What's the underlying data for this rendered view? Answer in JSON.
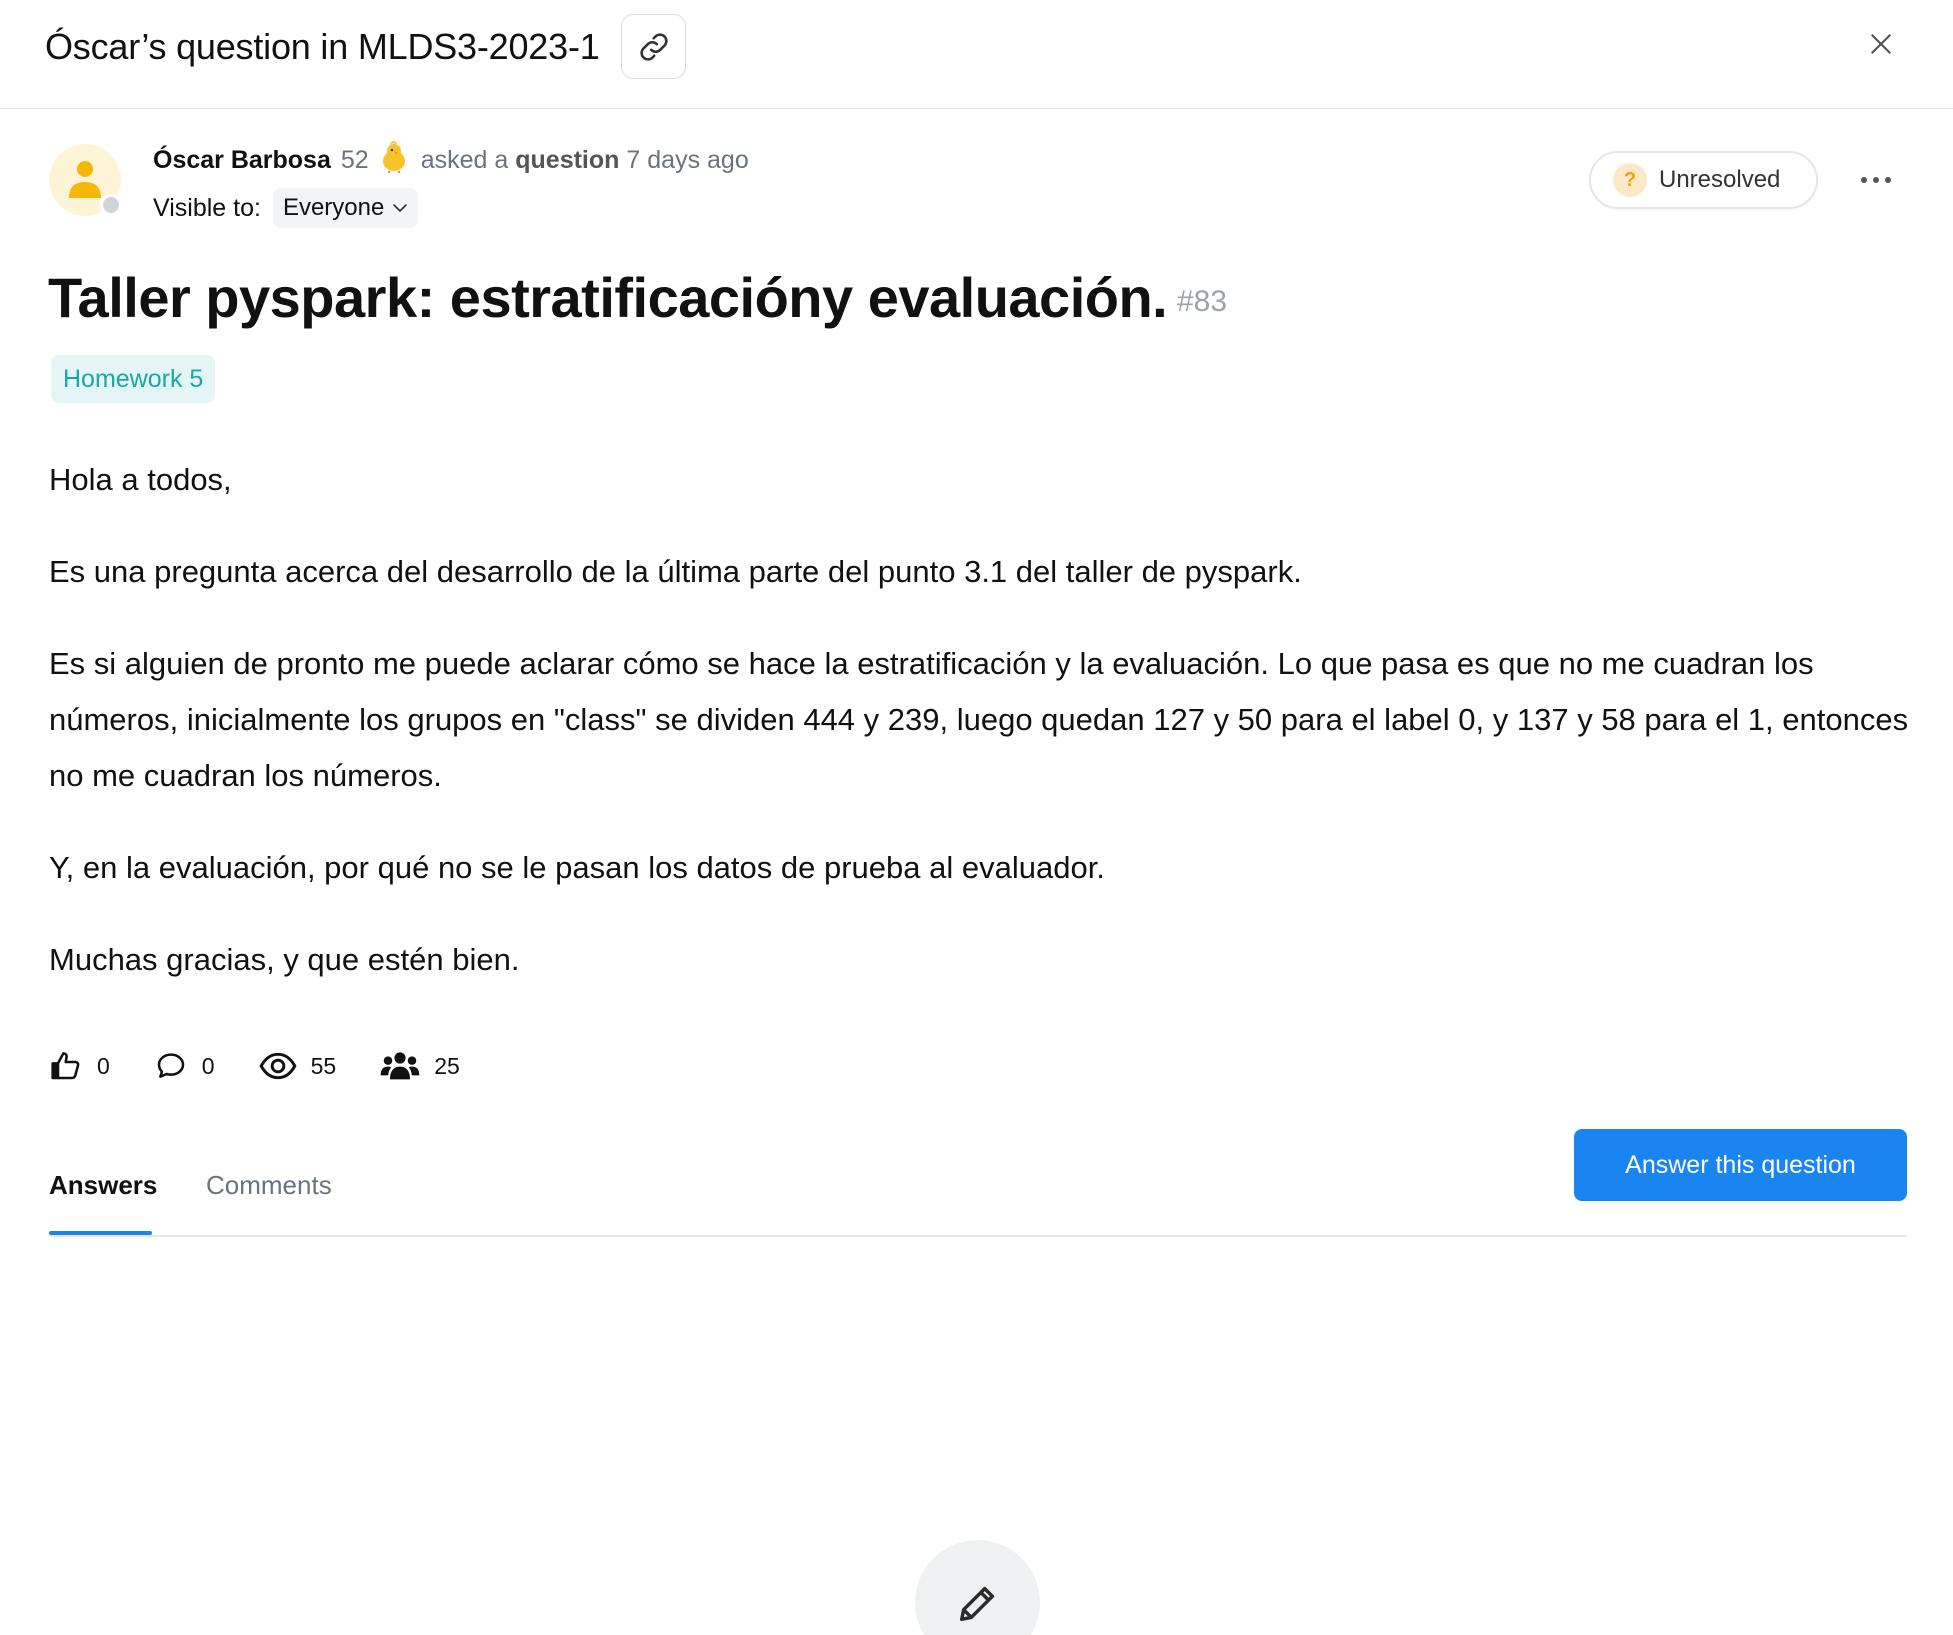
{
  "header": {
    "title": "Óscar’s question in MLDS3-2023-1",
    "copy_link_icon": "link-icon",
    "close_icon": "close-icon"
  },
  "author": {
    "name": "Óscar Barbosa",
    "score": "52",
    "badge_icon": "chick-icon",
    "action_prefix": "asked a",
    "action_object": "question",
    "time": "7 days ago",
    "visible_label": "Visible to:",
    "visibility": "Everyone"
  },
  "status": {
    "label": "Unresolved",
    "icon_glyph": "?",
    "color": "#f59e0b"
  },
  "post": {
    "title": "Taller pyspark: estratificacióny evaluación.",
    "number": "#83",
    "tag": "Homework 5",
    "paragraphs": [
      "Hola a todos,",
      "Es una pregunta acerca del desarrollo de la última parte del punto 3.1 del taller de pyspark.",
      "Es si alguien de pronto me puede aclarar cómo se hace la estratificación y la evaluación. Lo que pasa es que no me cuadran los números, inicialmente los grupos en \"class\" se dividen 444 y 239, luego quedan 127 y 50 para el label 0, y 137 y 58 para el 1, entonces no me cuadran los números.",
      "Y, en la evaluación, por qué no se le pasan los datos de prueba al evaluador.",
      "Muchas gracias, y que estén bien."
    ]
  },
  "stats": {
    "likes": "0",
    "comments": "0",
    "views": "55",
    "participants": "25"
  },
  "tabs": {
    "answers": "Answers",
    "comments": "Comments",
    "active": "Answers"
  },
  "actions": {
    "answer_button": "Answer this question"
  },
  "colors": {
    "primary": "#1a84f0",
    "tag_text": "#1ba8a0",
    "tag_bg": "#e3f6f5"
  }
}
